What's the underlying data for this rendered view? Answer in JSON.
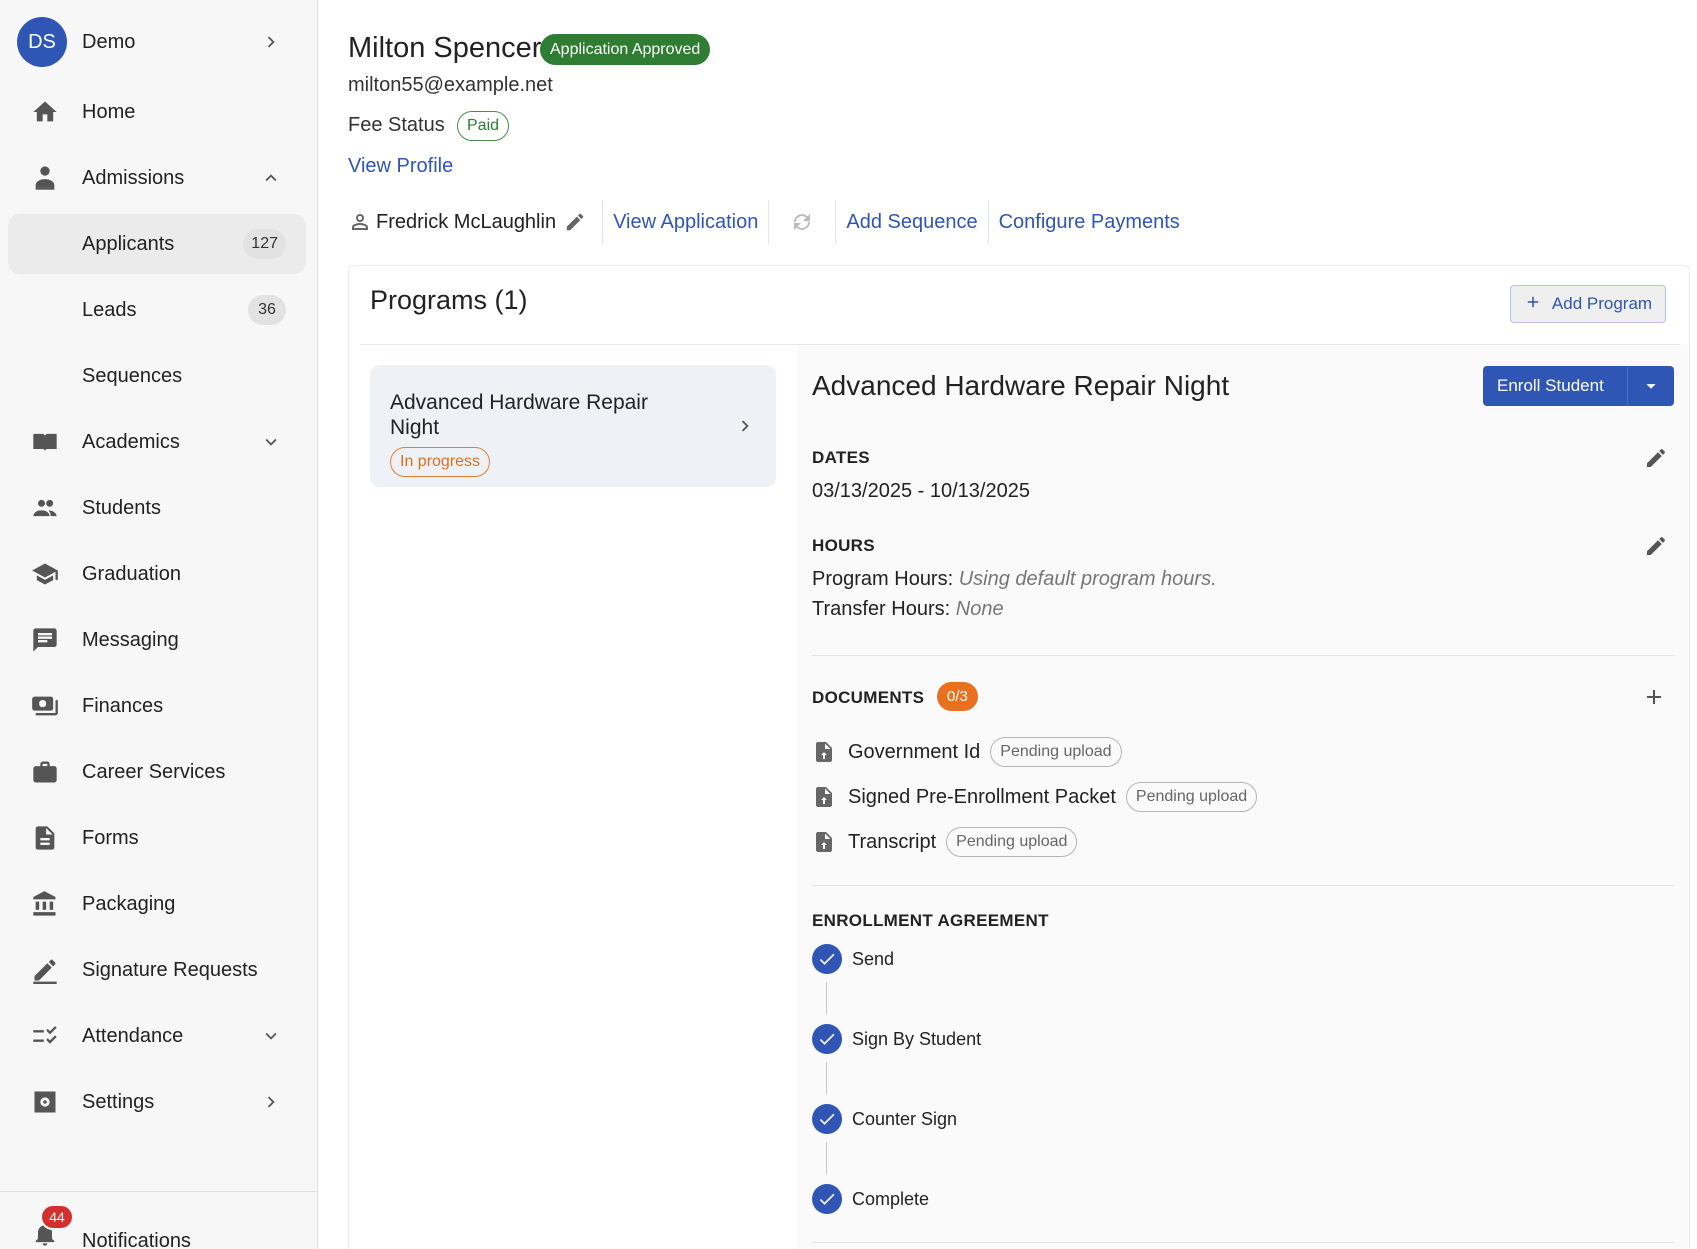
{
  "sidebar": {
    "org": {
      "initials": "DS",
      "name": "Demo"
    },
    "items": [
      {
        "label": "Home"
      },
      {
        "label": "Admissions"
      },
      {
        "label": "Applicants",
        "badge": "127"
      },
      {
        "label": "Leads",
        "badge": "36"
      },
      {
        "label": "Sequences"
      },
      {
        "label": "Academics"
      },
      {
        "label": "Students"
      },
      {
        "label": "Graduation"
      },
      {
        "label": "Messaging"
      },
      {
        "label": "Finances"
      },
      {
        "label": "Career Services"
      },
      {
        "label": "Forms"
      },
      {
        "label": "Packaging"
      },
      {
        "label": "Signature Requests"
      },
      {
        "label": "Attendance"
      },
      {
        "label": "Settings"
      }
    ],
    "notifications": {
      "label": "Notifications",
      "count": "44"
    }
  },
  "header": {
    "name": "Milton Spencer",
    "status_chip": "Application Approved",
    "email": "milton55@example.net",
    "fee_status_label": "Fee Status",
    "fee_status_value": "Paid",
    "view_profile": "View Profile"
  },
  "actions": {
    "assignee": "Fredrick McLaughlin",
    "view_application": "View Application",
    "add_sequence": "Add Sequence",
    "configure_payments": "Configure Payments"
  },
  "programs": {
    "title": "Programs (1)",
    "add_program": "Add Program",
    "list": [
      {
        "title": "Advanced Hardware Repair Night",
        "status": "In progress"
      }
    ],
    "detail": {
      "title": "Advanced Hardware Repair Night",
      "enroll_button": "Enroll Student",
      "dates_heading": "DATES",
      "dates_value": "03/13/2025 - 10/13/2025",
      "hours_heading": "HOURS",
      "program_hours_label": "Program Hours:",
      "program_hours_value": "Using default program hours.",
      "transfer_hours_label": "Transfer Hours:",
      "transfer_hours_value": "None",
      "documents_heading": "DOCUMENTS",
      "documents_count": "0/3",
      "documents": [
        {
          "name": "Government Id",
          "status": "Pending upload"
        },
        {
          "name": "Signed Pre-Enrollment Packet",
          "status": "Pending upload"
        },
        {
          "name": "Transcript",
          "status": "Pending upload"
        }
      ],
      "agreement_heading": "ENROLLMENT AGREEMENT",
      "agreement_steps": [
        {
          "label": "Send"
        },
        {
          "label": "Sign By Student"
        },
        {
          "label": "Counter Sign"
        },
        {
          "label": "Complete"
        }
      ]
    }
  },
  "colors": {
    "primary": "#2f55b5",
    "approved": "#2e7d32",
    "progress": "#e8701f",
    "notification": "#d32f2f"
  }
}
